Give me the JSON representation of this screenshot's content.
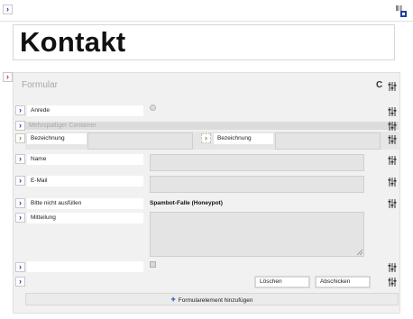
{
  "page": {
    "title": "Kontakt"
  },
  "form": {
    "title": "Formular",
    "fields": {
      "anrede_label": "Anrede",
      "container_label": "Mehrspaltiger Container",
      "bezeichnung_left_label": "Bezeichnung",
      "bezeichnung_right_label": "Bezeichnung",
      "name_label": "Name",
      "email_label": "E-Mail",
      "honeypot_label": "Bitte nicht ausfüllen",
      "honeypot_value": "Spambot-Falle (Honeypot)",
      "mitteilung_label": "Mitteilung"
    },
    "buttons": {
      "loeschen": "Löschen",
      "abschicken": "Abschicken"
    },
    "add_element": "Formularelement hinzufügen"
  },
  "icons": {
    "expand": "chevron-right-icon",
    "settings": "sliders-icon",
    "refresh": "refresh-icon",
    "plus": "plus-icon"
  },
  "colors": {
    "accent_blue": "#1a3fa6",
    "accent_red": "#c0282d",
    "panel_bg": "#f1f1f1"
  }
}
